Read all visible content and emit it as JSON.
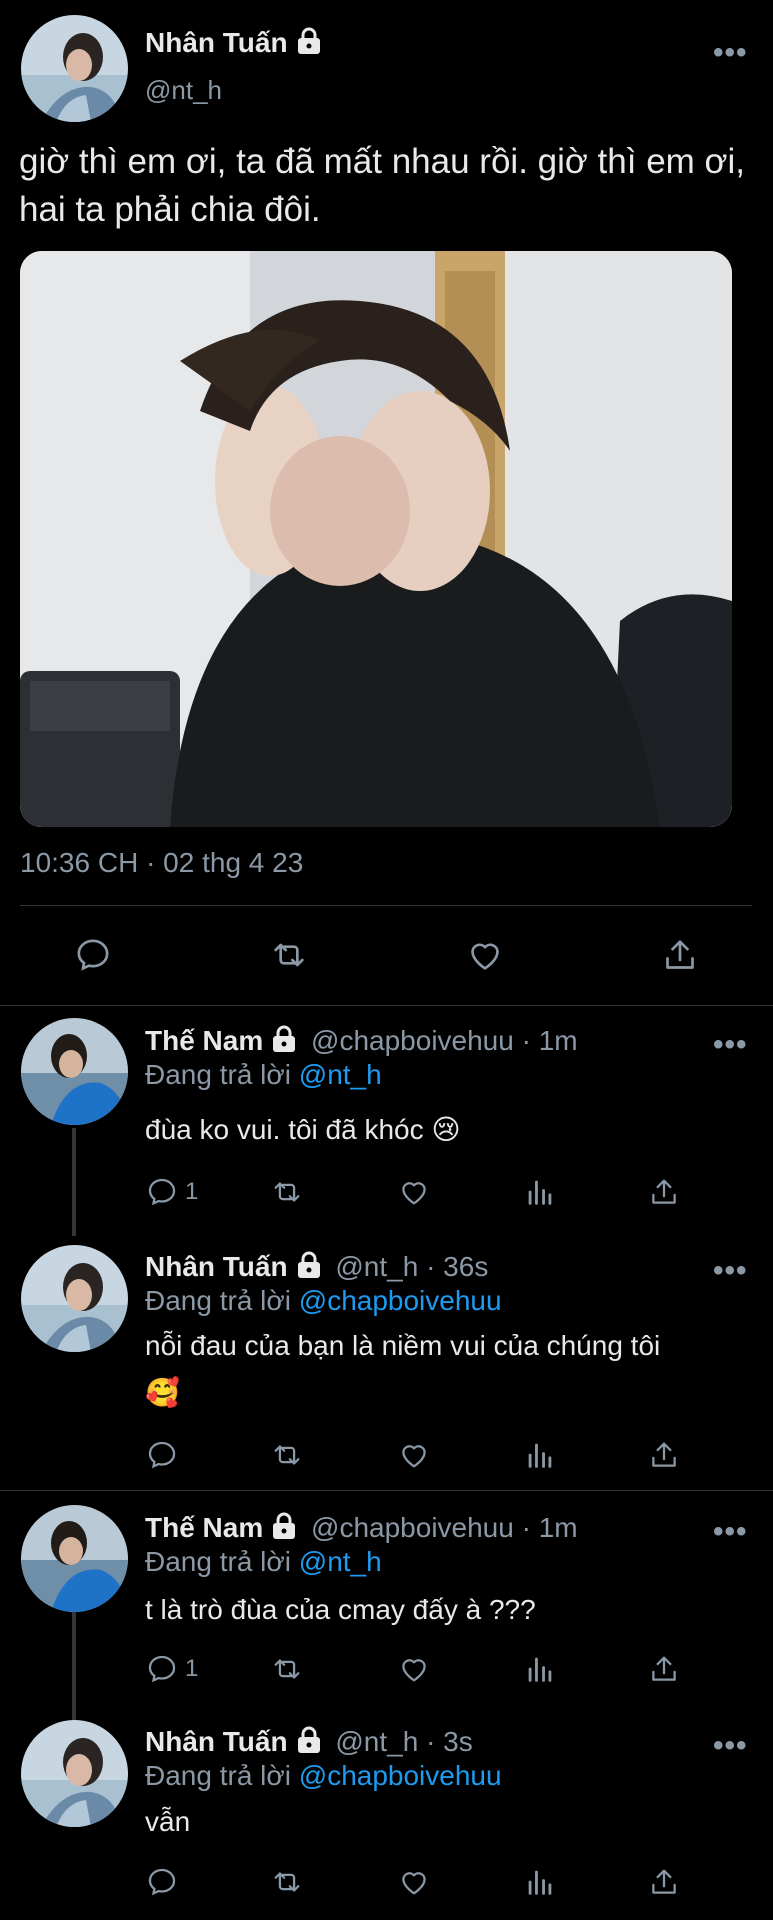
{
  "main_tweet": {
    "display_name": "Nhân Tuấn",
    "handle": "@nt_h",
    "text": "giờ thì em ơi, ta đã mất nhau rồi. giờ thì em ơi, hai ta phải chia đôi.",
    "timestamp": "10:36 CH · 02 thg 4 23",
    "more_label": "•••",
    "actions": [
      "reply-icon",
      "retweet-icon",
      "like-icon",
      "share-icon"
    ]
  },
  "replying_label": "Đang trả lời",
  "replies": [
    {
      "display_name": "Thế Nam",
      "handle": "@chapboivehuu",
      "time": "· 1m",
      "reply_to": "@nt_h",
      "text_line1": "đùa ko vui. tôi đã khóc",
      "text_line2": "",
      "emoji": "😢",
      "reply_count": "1",
      "more_label": "•••"
    },
    {
      "display_name": "Nhân Tuấn",
      "handle": "@nt_h",
      "time": "· 36s",
      "reply_to": "@chapboivehuu",
      "text_line1": "nỗi đau của bạn là niềm vui của chúng tôi",
      "text_line2": "",
      "emoji": "🥰",
      "reply_count": "",
      "more_label": "•••"
    },
    {
      "display_name": "Thế Nam",
      "handle": "@chapboivehuu",
      "time": "· 1m",
      "reply_to": "@nt_h",
      "text_line1": "t là trò đùa của cmay đấy à ???",
      "text_line2": "",
      "emoji": "",
      "reply_count": "1",
      "more_label": "•••"
    },
    {
      "display_name": "Nhân Tuấn",
      "handle": "@nt_h",
      "time": "· 3s",
      "reply_to": "@chapboivehuu",
      "text_line1": "vẫn",
      "text_line2": "",
      "emoji": "",
      "reply_count": "",
      "more_label": "•••"
    }
  ],
  "colors": {
    "background": "#000000",
    "text": "#e7e9ea",
    "secondary": "#8b98a5",
    "link": "#1d9bf0",
    "divider": "#2f3336"
  }
}
